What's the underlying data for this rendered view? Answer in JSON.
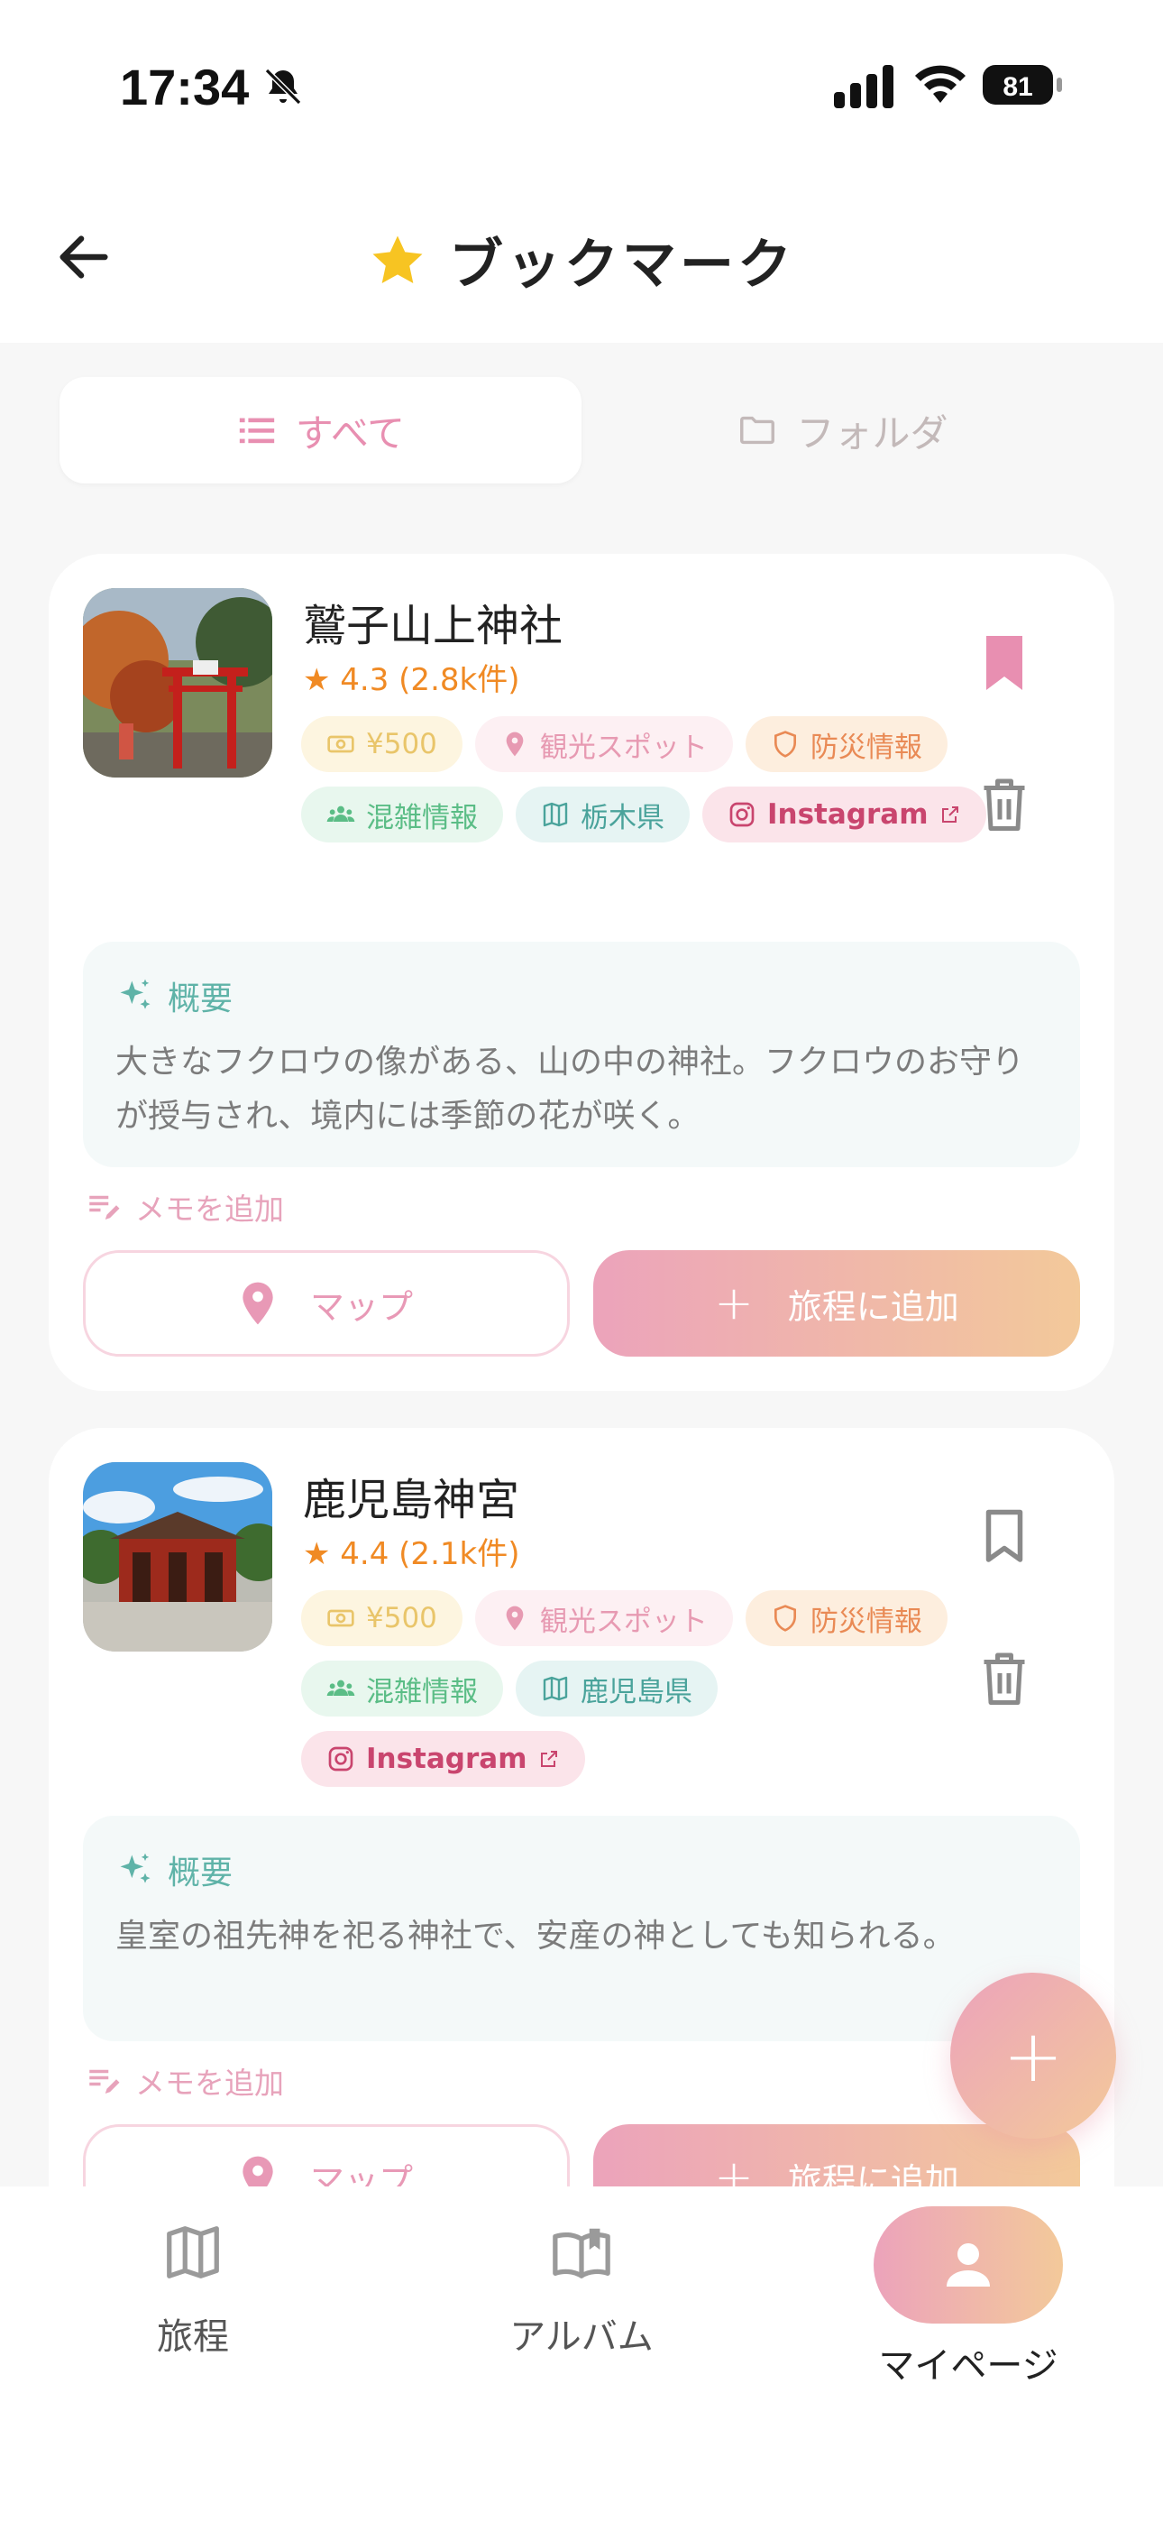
{
  "status_bar": {
    "time": "17:34",
    "battery": "81"
  },
  "header": {
    "title": "ブックマーク"
  },
  "tabs": [
    {
      "label": "すべて",
      "active": true
    },
    {
      "label": "フォルダ",
      "active": false
    }
  ],
  "places": [
    {
      "name": "鷲子山上神社",
      "rating": "★ 4.3 (2.8k件)",
      "price": "¥500",
      "category": "観光スポット",
      "disaster": "防災情報",
      "crowd": "混雑情報",
      "prefecture": "栃木県",
      "instagram": "Instagram",
      "summary_label": "概要",
      "summary": "大きなフクロウの像がある、山の中の神社。フクロウのお守りが授与され、境内には季節の花が咲く。",
      "memo": "メモを追加",
      "map_btn": "マップ",
      "add_btn": "旅程に追加",
      "bookmarked": true
    },
    {
      "name": "鹿児島神宮",
      "rating": "★ 4.4 (2.1k件)",
      "price": "¥500",
      "category": "観光スポット",
      "disaster": "防災情報",
      "crowd": "混雑情報",
      "prefecture": "鹿児島県",
      "instagram": "Instagram",
      "summary_label": "概要",
      "summary": "皇室の祖先神を祀る神社で、安産の神としても知られる。",
      "memo": "メモを追加",
      "map_btn": "マップ",
      "add_btn": "旅程に追加",
      "bookmarked": false
    }
  ],
  "fab": "+",
  "bottom_nav": [
    {
      "label": "旅程",
      "icon": "map-icon"
    },
    {
      "label": "アルバム",
      "icon": "album-icon"
    },
    {
      "label": "マイページ",
      "icon": "user-icon",
      "active": true
    }
  ],
  "colors": {
    "accent_pink": "#e88fb1",
    "accent_gold": "#f3c99a",
    "rating": "#f08a24"
  }
}
